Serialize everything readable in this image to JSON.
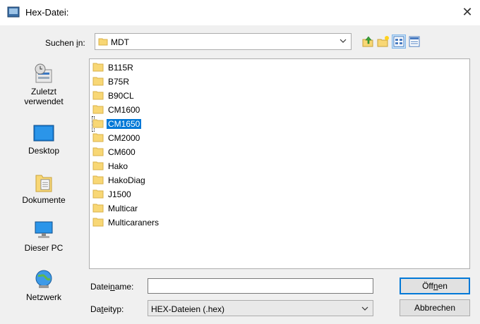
{
  "window": {
    "title": "Hex-Datei:",
    "close": "✕"
  },
  "lookin": {
    "label_pre": "Suchen ",
    "label_accel": "i",
    "label_post": "n:",
    "value": "MDT"
  },
  "toolbar": {
    "icons": [
      "up-folder-icon",
      "new-folder-icon",
      "view-list-icon",
      "view-details-icon"
    ]
  },
  "places": [
    {
      "label_line1": "Zuletzt",
      "label_line2": "verwendet",
      "icon": "recent-icon"
    },
    {
      "label_line1": "Desktop",
      "label_line2": "",
      "icon": "desktop-icon"
    },
    {
      "label_line1": "Dokumente",
      "label_line2": "",
      "icon": "documents-icon"
    },
    {
      "label_line1": "Dieser PC",
      "label_line2": "",
      "icon": "this-pc-icon"
    },
    {
      "label_line1": "Netzwerk",
      "label_line2": "",
      "icon": "network-icon"
    }
  ],
  "files": [
    {
      "name": "B115R",
      "selected": false
    },
    {
      "name": "B75R",
      "selected": false
    },
    {
      "name": "B90CL",
      "selected": false
    },
    {
      "name": "CM1600",
      "selected": false
    },
    {
      "name": "CM1650",
      "selected": true
    },
    {
      "name": "CM2000",
      "selected": false
    },
    {
      "name": "CM600",
      "selected": false
    },
    {
      "name": "Hako",
      "selected": false
    },
    {
      "name": "HakoDiag",
      "selected": false
    },
    {
      "name": "J1500",
      "selected": false
    },
    {
      "name": "Multicar",
      "selected": false
    },
    {
      "name": "Multicaraners",
      "selected": false
    }
  ],
  "filename": {
    "label_pre": "Datei",
    "label_accel": "n",
    "label_post": "ame:",
    "value": ""
  },
  "filetype": {
    "label_pre": "Da",
    "label_accel": "t",
    "label_post": "eityp:",
    "value": "HEX-Dateien (.hex)"
  },
  "buttons": {
    "open_pre": "Öff",
    "open_accel": "n",
    "open_post": "en",
    "cancel": "Abbrechen"
  },
  "colors": {
    "selection": "#0078d7",
    "folder": "#f8d775"
  }
}
